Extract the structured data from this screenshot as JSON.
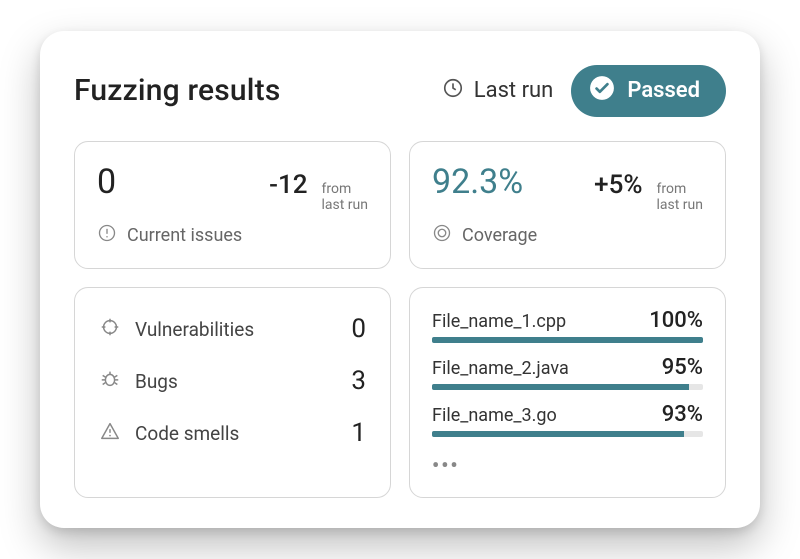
{
  "header": {
    "title": "Fuzzing results",
    "last_run_label": "Last run",
    "status_label": "Passed"
  },
  "issues_card": {
    "value": "0",
    "delta": "-12",
    "hint_line1": "from",
    "hint_line2": "last run",
    "label": "Current issues"
  },
  "coverage_card": {
    "value": "92.3%",
    "delta": "+5%",
    "hint_line1": "from",
    "hint_line2": "last run",
    "label": "Coverage"
  },
  "breakdown": {
    "items": [
      {
        "name": "Vulnerabilities",
        "count": "0"
      },
      {
        "name": "Bugs",
        "count": "3"
      },
      {
        "name": "Code smells",
        "count": "1"
      }
    ]
  },
  "files": {
    "items": [
      {
        "name": "File_name_1.cpp",
        "pct_label": "100%",
        "pct": 100
      },
      {
        "name": "File_name_2.java",
        "pct_label": "95%",
        "pct": 95
      },
      {
        "name": "File_name_3.go",
        "pct_label": "93%",
        "pct": 93
      }
    ],
    "more": "•••"
  },
  "colors": {
    "accent": "#3f7f8c"
  }
}
